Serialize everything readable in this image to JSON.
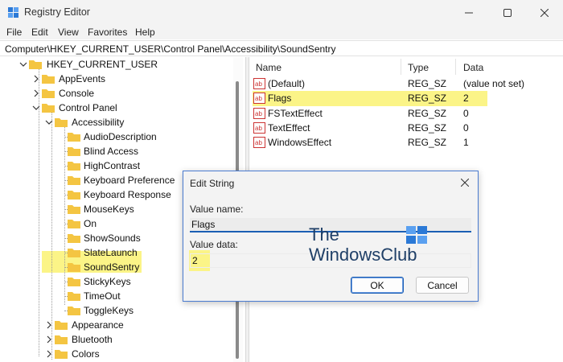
{
  "window": {
    "title": "Registry Editor"
  },
  "menu": [
    "File",
    "Edit",
    "View",
    "Favorites",
    "Help"
  ],
  "address": {
    "path": "Computer\\HKEY_CURRENT_USER\\Control Panel\\Accessibility\\SoundSentry"
  },
  "tree": {
    "items": [
      {
        "label": "HKEY_CURRENT_USER",
        "expanded": true
      },
      {
        "label": "AppEvents",
        "expanded": false
      },
      {
        "label": "Console",
        "expanded": false
      },
      {
        "label": "Control Panel",
        "expanded": true
      },
      {
        "label": "Accessibility",
        "expanded": true
      },
      {
        "label": "AudioDescription"
      },
      {
        "label": "Blind Access"
      },
      {
        "label": "HighContrast"
      },
      {
        "label": "Keyboard Preference"
      },
      {
        "label": "Keyboard Response"
      },
      {
        "label": "MouseKeys"
      },
      {
        "label": "On"
      },
      {
        "label": "ShowSounds"
      },
      {
        "label": "SlateLaunch"
      },
      {
        "label": "SoundSentry",
        "selected": true
      },
      {
        "label": "StickyKeys"
      },
      {
        "label": "TimeOut"
      },
      {
        "label": "ToggleKeys"
      },
      {
        "label": "Appearance",
        "expanded": false
      },
      {
        "label": "Bluetooth",
        "expanded": false
      },
      {
        "label": "Colors",
        "expanded": false
      }
    ]
  },
  "list": {
    "headers": {
      "name": "Name",
      "type": "Type",
      "data": "Data"
    },
    "rows": [
      {
        "name": "(Default)",
        "type": "REG_SZ",
        "data": "(value not set)"
      },
      {
        "name": "Flags",
        "type": "REG_SZ",
        "data": "2",
        "highlighted": true
      },
      {
        "name": "FSTextEffect",
        "type": "REG_SZ",
        "data": "0"
      },
      {
        "name": "TextEffect",
        "type": "REG_SZ",
        "data": "0"
      },
      {
        "name": "WindowsEffect",
        "type": "REG_SZ",
        "data": "1"
      }
    ]
  },
  "dialog": {
    "title": "Edit String",
    "value_name_label": "Value name:",
    "value_name": "Flags",
    "value_data_label": "Value data:",
    "value_data": "2",
    "ok_label": "OK",
    "cancel_label": "Cancel"
  },
  "watermark": {
    "line1": "The",
    "line2": "WindowsClub"
  },
  "colors": {
    "highlight": "#fbf487",
    "accent": "#1c5fb4",
    "folder": "#f4c542"
  }
}
